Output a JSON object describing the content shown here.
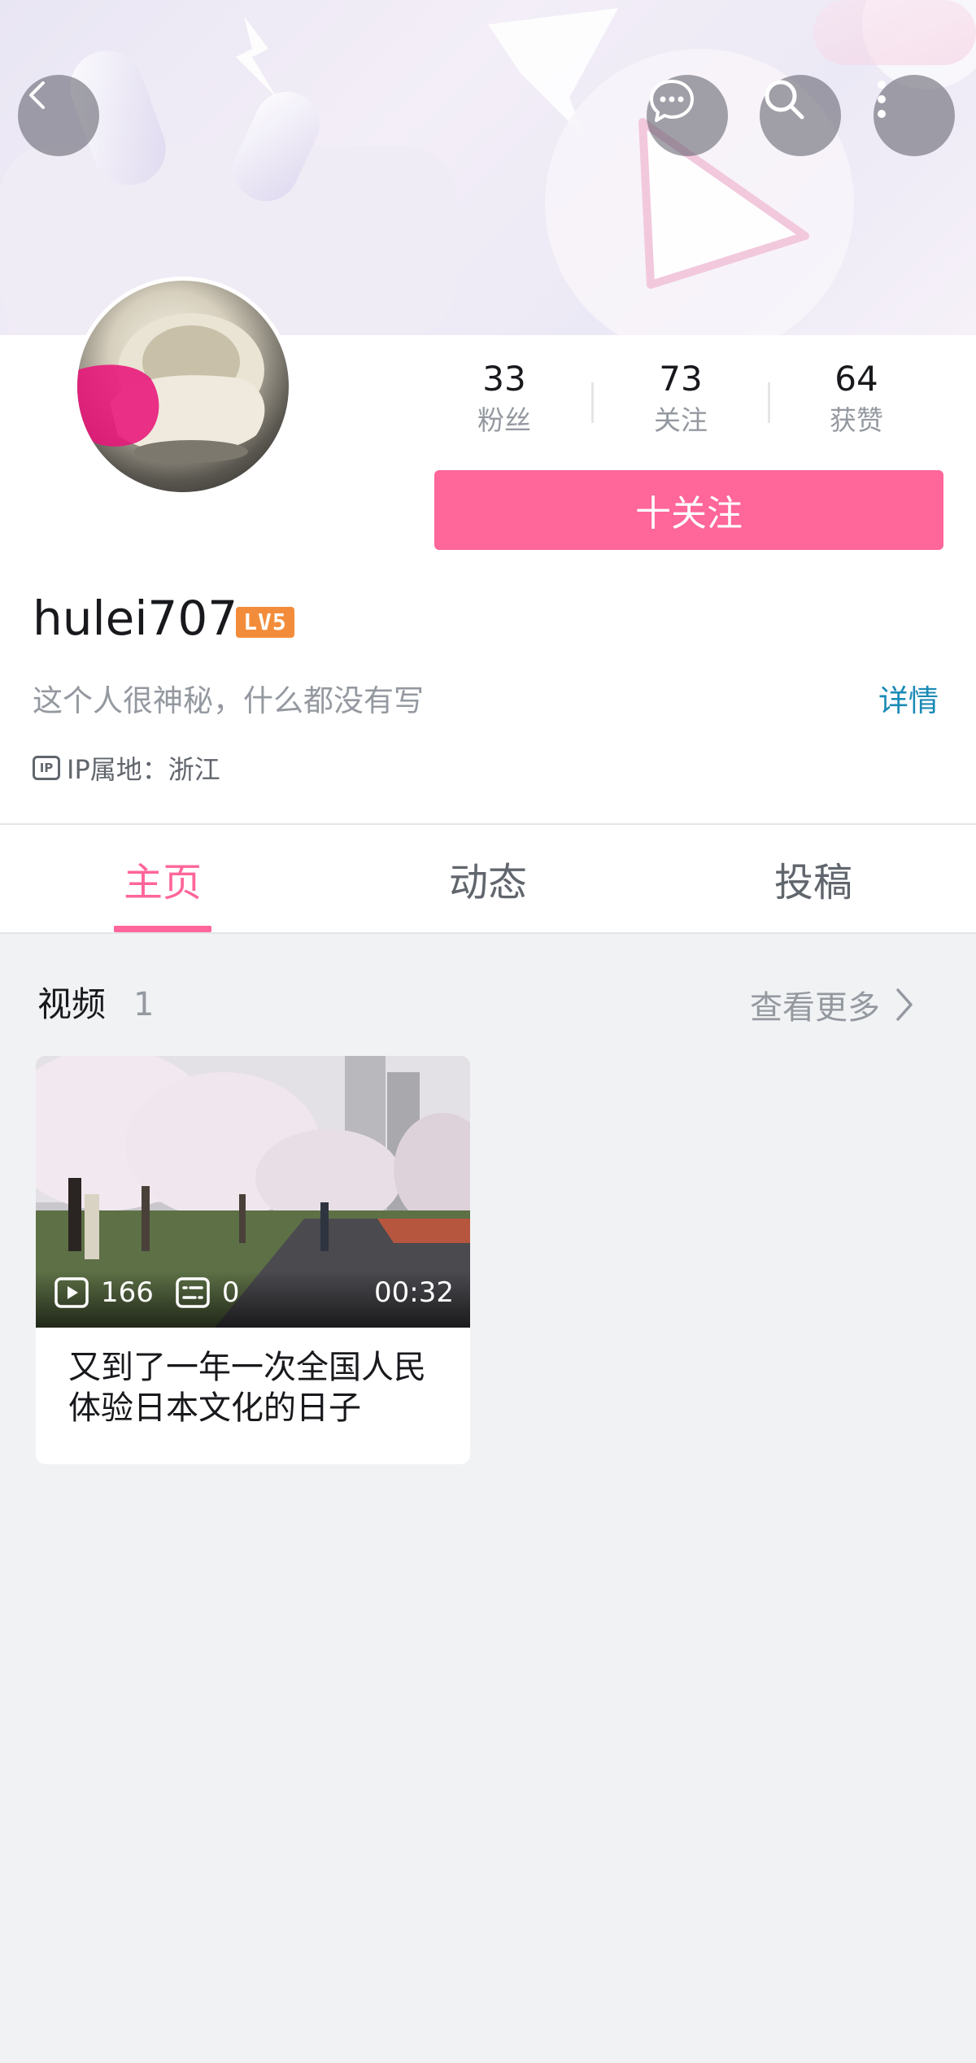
{
  "profile": {
    "username": "hulei707",
    "level_badge": "LV5",
    "bio": "这个人很神秘，什么都没有写",
    "detail_link": "详情",
    "ip_icon_text": "IP",
    "ip_location": "IP属地：浙江"
  },
  "stats": [
    {
      "value": "33",
      "label": "粉丝"
    },
    {
      "value": "73",
      "label": "关注"
    },
    {
      "value": "64",
      "label": "获赞"
    }
  ],
  "follow_button": "十关注",
  "tabs": [
    {
      "label": "主页",
      "active": true
    },
    {
      "label": "动态",
      "active": false
    },
    {
      "label": "投稿",
      "active": false
    }
  ],
  "videos_section": {
    "title": "视频",
    "count": "1",
    "see_more": "查看更多"
  },
  "videos": [
    {
      "plays": "166",
      "comments": "0",
      "duration": "00:32",
      "title": "又到了一年一次全国人民体验日本文化的日子"
    }
  ],
  "icons": {
    "back": "chevron-left-icon",
    "message": "chat-bubble-icon",
    "search": "search-icon",
    "more": "more-vertical-icon",
    "play": "play-icon",
    "danmaku": "danmaku-icon",
    "see_more": "chevron-right-icon"
  },
  "colors": {
    "accent": "#ff6699",
    "link": "#1a8ab6",
    "level_badge": "#f38c3a",
    "page_background": "#f1f2f4"
  }
}
